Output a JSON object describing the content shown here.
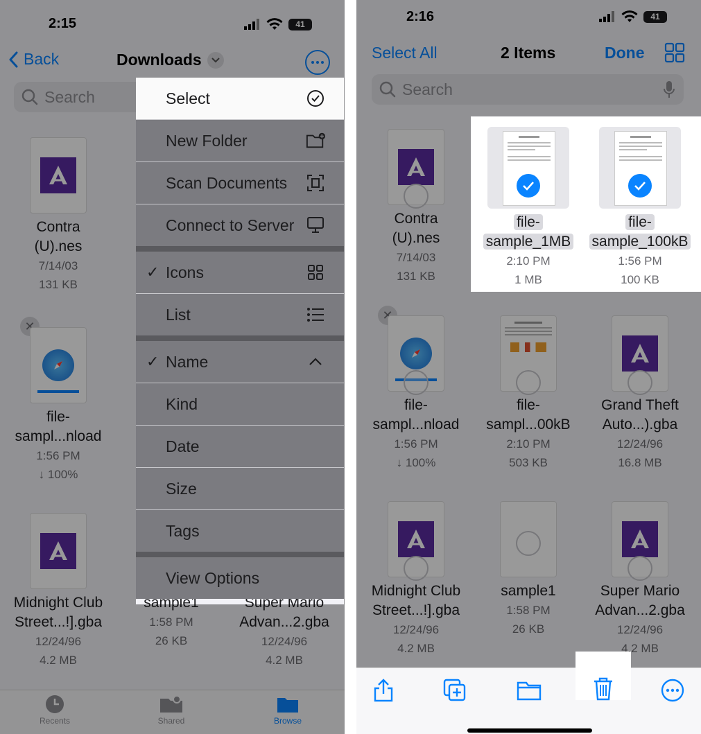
{
  "left": {
    "time": "2:15",
    "battery": "41",
    "back_label": "Back",
    "title": "Downloads",
    "search_placeholder": "Search",
    "files": [
      {
        "name1": "Contra",
        "name2": "(U).nes",
        "date": "7/14/03",
        "size": "131 KB"
      },
      {
        "name1": "file-",
        "name2": "sampl...nload",
        "date": "1:56 PM",
        "size": "↓ 100%"
      },
      {
        "name1": "Midnight Club",
        "name2": "Street...!].gba",
        "date": "12/24/96",
        "size": "4.2 MB"
      },
      {
        "name1": "sample1",
        "name2": "",
        "date": "1:58 PM",
        "size": "26 KB"
      },
      {
        "name1": "Super Mario",
        "name2": "Advan...2.gba",
        "date": "12/24/96",
        "size": "4.2 MB"
      }
    ],
    "menu": {
      "select": "Select",
      "new_folder": "New Folder",
      "scan_documents": "Scan Documents",
      "connect_to_server": "Connect to Server",
      "icons": "Icons",
      "list": "List",
      "name": "Name",
      "kind": "Kind",
      "date": "Date",
      "size": "Size",
      "tags": "Tags",
      "view_options": "View Options"
    },
    "tabs": {
      "recents": "Recents",
      "shared": "Shared",
      "browse": "Browse"
    }
  },
  "right": {
    "time": "2:16",
    "battery": "41",
    "select_all": "Select All",
    "title": "2 Items",
    "done": "Done",
    "search_placeholder": "Search",
    "files": [
      {
        "name1": "Contra",
        "name2": "(U).nes",
        "date": "7/14/03",
        "size": "131 KB"
      },
      {
        "name1": "file-",
        "name2": "sample_1MB",
        "date": "2:10 PM",
        "size": "1 MB"
      },
      {
        "name1": "file-",
        "name2": "sample_100kB",
        "date": "1:56 PM",
        "size": "100 KB"
      },
      {
        "name1": "file-",
        "name2": "sampl...nload",
        "date": "1:56 PM",
        "size": "↓ 100%"
      },
      {
        "name1": "file-",
        "name2": "sampl...00kB",
        "date": "2:10 PM",
        "size": "503 KB"
      },
      {
        "name1": "Grand Theft",
        "name2": "Auto...).gba",
        "date": "12/24/96",
        "size": "16.8 MB"
      },
      {
        "name1": "Midnight Club",
        "name2": "Street...!].gba",
        "date": "12/24/96",
        "size": "4.2 MB"
      },
      {
        "name1": "sample1",
        "name2": "",
        "date": "1:58 PM",
        "size": "26 KB"
      },
      {
        "name1": "Super Mario",
        "name2": "Advan...2.gba",
        "date": "12/24/96",
        "size": "4.2 MB"
      }
    ]
  },
  "colors": {
    "accent": "#0a84ff",
    "app_icon": "#5a2ca0"
  }
}
